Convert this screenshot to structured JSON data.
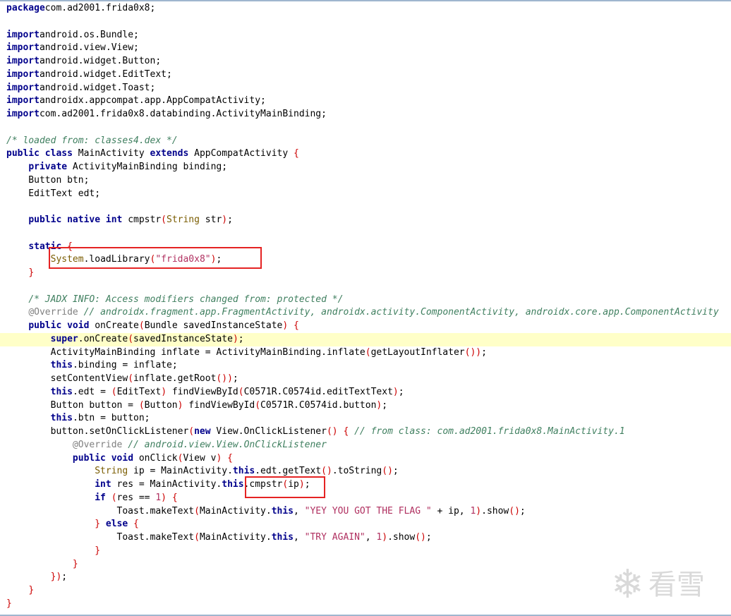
{
  "code": {
    "lines": [
      {
        "tokens": [
          [
            "kw",
            "package"
          ],
          [
            "",
            "com.ad2001.frida0x8;"
          ]
        ]
      },
      {
        "tokens": []
      },
      {
        "tokens": [
          [
            "kw",
            "import"
          ],
          [
            "",
            "android.os.Bundle;"
          ]
        ]
      },
      {
        "tokens": [
          [
            "kw",
            "import"
          ],
          [
            "",
            "android.view.View;"
          ]
        ]
      },
      {
        "tokens": [
          [
            "kw",
            "import"
          ],
          [
            "",
            "android.widget.Button;"
          ]
        ]
      },
      {
        "tokens": [
          [
            "kw",
            "import"
          ],
          [
            "",
            "android.widget.EditText;"
          ]
        ]
      },
      {
        "tokens": [
          [
            "kw",
            "import"
          ],
          [
            "",
            "android.widget.Toast;"
          ]
        ]
      },
      {
        "tokens": [
          [
            "kw",
            "import"
          ],
          [
            "",
            "androidx.appcompat.app.AppCompatActivity;"
          ]
        ]
      },
      {
        "tokens": [
          [
            "kw",
            "import"
          ],
          [
            "",
            "com.ad2001.frida0x8.databinding.ActivityMainBinding;"
          ]
        ]
      },
      {
        "tokens": []
      },
      {
        "tokens": [
          [
            "cm",
            "/* loaded from: classes4.dex */"
          ]
        ]
      },
      {
        "tokens": [
          [
            "kw",
            "public class"
          ],
          [
            "",
            " MainActivity "
          ],
          [
            "kw",
            "extends"
          ],
          [
            "",
            " AppCompatActivity "
          ],
          [
            "pn",
            "{"
          ]
        ]
      },
      {
        "tokens": [
          [
            "",
            "    "
          ],
          [
            "kw",
            "private"
          ],
          [
            "",
            " ActivityMainBinding binding;"
          ]
        ]
      },
      {
        "tokens": [
          [
            "",
            "    Button btn;"
          ]
        ]
      },
      {
        "tokens": [
          [
            "",
            "    EditText edt;"
          ]
        ]
      },
      {
        "tokens": []
      },
      {
        "tokens": [
          [
            "",
            "    "
          ],
          [
            "kw",
            "public native int"
          ],
          [
            "",
            " cmpstr"
          ],
          [
            "pn",
            "("
          ],
          [
            "cls",
            "String"
          ],
          [
            "",
            " str"
          ],
          [
            "pn",
            ")"
          ],
          [
            "",
            ";"
          ]
        ]
      },
      {
        "tokens": []
      },
      {
        "tokens": [
          [
            "",
            "    "
          ],
          [
            "kw",
            "static"
          ],
          [
            "",
            " "
          ],
          [
            "pn",
            "{"
          ]
        ]
      },
      {
        "tokens": [
          [
            "",
            "        "
          ],
          [
            "sys",
            "System"
          ],
          [
            "",
            ".loadLibrary"
          ],
          [
            "pn",
            "("
          ],
          [
            "st",
            "\"frida0x8\""
          ],
          [
            "pn",
            ")"
          ],
          [
            "",
            ";"
          ]
        ]
      },
      {
        "tokens": [
          [
            "",
            "    "
          ],
          [
            "pn",
            "}"
          ]
        ]
      },
      {
        "tokens": []
      },
      {
        "tokens": [
          [
            "",
            "    "
          ],
          [
            "cm",
            "/* JADX INFO: Access modifiers changed from: protected */"
          ]
        ]
      },
      {
        "tokens": [
          [
            "",
            "    "
          ],
          [
            "an",
            "@Override"
          ],
          [
            "",
            " "
          ],
          [
            "cm",
            "// androidx.fragment.app.FragmentActivity, androidx.activity.ComponentActivity, androidx.core.app.ComponentActivity"
          ]
        ]
      },
      {
        "tokens": [
          [
            "",
            "    "
          ],
          [
            "kw",
            "public void"
          ],
          [
            "",
            " onCreate"
          ],
          [
            "pn",
            "("
          ],
          [
            "",
            "Bundle savedInstanceState"
          ],
          [
            "pn",
            ")"
          ],
          [
            "",
            " "
          ],
          [
            "pn",
            "{"
          ]
        ]
      },
      {
        "hl": true,
        "tokens": [
          [
            "",
            "        "
          ],
          [
            "kw",
            "super"
          ],
          [
            "",
            ".onCreate"
          ],
          [
            "pn",
            "("
          ],
          [
            "",
            "savedInstanceState"
          ],
          [
            "pn",
            ")"
          ],
          [
            "",
            ";"
          ]
        ]
      },
      {
        "tokens": [
          [
            "",
            "        ActivityMainBinding inflate = ActivityMainBinding.inflate"
          ],
          [
            "pn",
            "("
          ],
          [
            "",
            "getLayoutInflater"
          ],
          [
            "pn",
            "())"
          ],
          [
            "",
            ";"
          ]
        ]
      },
      {
        "tokens": [
          [
            "",
            "        "
          ],
          [
            "kw",
            "this"
          ],
          [
            "",
            ".binding = inflate;"
          ]
        ]
      },
      {
        "tokens": [
          [
            "",
            "        setContentView"
          ],
          [
            "pn",
            "("
          ],
          [
            "",
            "inflate.getRoot"
          ],
          [
            "pn",
            "())"
          ],
          [
            "",
            ";"
          ]
        ]
      },
      {
        "tokens": [
          [
            "",
            "        "
          ],
          [
            "kw",
            "this"
          ],
          [
            "",
            ".edt = "
          ],
          [
            "pn",
            "("
          ],
          [
            "",
            "EditText"
          ],
          [
            "pn",
            ")"
          ],
          [
            "",
            " findViewById"
          ],
          [
            "pn",
            "("
          ],
          [
            "",
            "C0571R.C0574id.editTextText"
          ],
          [
            "pn",
            ")"
          ],
          [
            "",
            ";"
          ]
        ]
      },
      {
        "tokens": [
          [
            "",
            "        Button button = "
          ],
          [
            "pn",
            "("
          ],
          [
            "",
            "Button"
          ],
          [
            "pn",
            ")"
          ],
          [
            "",
            " findViewById"
          ],
          [
            "pn",
            "("
          ],
          [
            "",
            "C0571R.C0574id.button"
          ],
          [
            "pn",
            ")"
          ],
          [
            "",
            ";"
          ]
        ]
      },
      {
        "tokens": [
          [
            "",
            "        "
          ],
          [
            "kw",
            "this"
          ],
          [
            "",
            ".btn = button;"
          ]
        ]
      },
      {
        "tokens": [
          [
            "",
            "        button.setOnClickListener"
          ],
          [
            "pn",
            "("
          ],
          [
            "kw",
            "new"
          ],
          [
            "",
            " View.OnClickListener"
          ],
          [
            "pn",
            "()"
          ],
          [
            "",
            " "
          ],
          [
            "pn",
            "{"
          ],
          [
            "",
            " "
          ],
          [
            "cm",
            "// from class: com.ad2001.frida0x8.MainActivity.1"
          ]
        ]
      },
      {
        "tokens": [
          [
            "",
            "            "
          ],
          [
            "an",
            "@Override"
          ],
          [
            "",
            " "
          ],
          [
            "cm",
            "// android.view.View.OnClickListener"
          ]
        ]
      },
      {
        "tokens": [
          [
            "",
            "            "
          ],
          [
            "kw",
            "public void"
          ],
          [
            "",
            " onClick"
          ],
          [
            "pn",
            "("
          ],
          [
            "",
            "View v"
          ],
          [
            "pn",
            ")"
          ],
          [
            "",
            " "
          ],
          [
            "pn",
            "{"
          ]
        ]
      },
      {
        "tokens": [
          [
            "",
            "                "
          ],
          [
            "cls",
            "String"
          ],
          [
            "",
            " ip = MainActivity."
          ],
          [
            "kw",
            "this"
          ],
          [
            "",
            ".edt.getText"
          ],
          [
            "pn",
            "()"
          ],
          [
            "",
            ".toString"
          ],
          [
            "pn",
            "()"
          ],
          [
            "",
            ";"
          ]
        ]
      },
      {
        "tokens": [
          [
            "",
            "                "
          ],
          [
            "kw",
            "int"
          ],
          [
            "",
            " res = MainActivity."
          ],
          [
            "kw",
            "this"
          ],
          [
            "",
            ".cmpstr"
          ],
          [
            "pn",
            "("
          ],
          [
            "",
            "ip"
          ],
          [
            "pn",
            ")"
          ],
          [
            "",
            ";"
          ]
        ]
      },
      {
        "tokens": [
          [
            "",
            "                "
          ],
          [
            "kw",
            "if"
          ],
          [
            "",
            " "
          ],
          [
            "pn",
            "("
          ],
          [
            "",
            "res == "
          ],
          [
            "num",
            "1"
          ],
          [
            "pn",
            ")"
          ],
          [
            "",
            " "
          ],
          [
            "pn",
            "{"
          ]
        ]
      },
      {
        "tokens": [
          [
            "",
            "                    Toast.makeText"
          ],
          [
            "pn",
            "("
          ],
          [
            "",
            "MainActivity."
          ],
          [
            "kw",
            "this"
          ],
          [
            "",
            ", "
          ],
          [
            "st",
            "\"YEY YOU GOT THE FLAG \""
          ],
          [
            "",
            " + ip, "
          ],
          [
            "num",
            "1"
          ],
          [
            "pn",
            ")"
          ],
          [
            "",
            ".show"
          ],
          [
            "pn",
            "()"
          ],
          [
            "",
            ";"
          ]
        ]
      },
      {
        "tokens": [
          [
            "",
            "                "
          ],
          [
            "pn",
            "}"
          ],
          [
            "",
            " "
          ],
          [
            "kw",
            "else"
          ],
          [
            "",
            " "
          ],
          [
            "pn",
            "{"
          ]
        ]
      },
      {
        "tokens": [
          [
            "",
            "                    Toast.makeText"
          ],
          [
            "pn",
            "("
          ],
          [
            "",
            "MainActivity."
          ],
          [
            "kw",
            "this"
          ],
          [
            "",
            ", "
          ],
          [
            "st",
            "\"TRY AGAIN\""
          ],
          [
            "",
            ", "
          ],
          [
            "num",
            "1"
          ],
          [
            "pn",
            ")"
          ],
          [
            "",
            ".show"
          ],
          [
            "pn",
            "()"
          ],
          [
            "",
            ";"
          ]
        ]
      },
      {
        "tokens": [
          [
            "",
            "                "
          ],
          [
            "pn",
            "}"
          ]
        ]
      },
      {
        "tokens": [
          [
            "",
            "            "
          ],
          [
            "pn",
            "}"
          ]
        ]
      },
      {
        "tokens": [
          [
            "",
            "        "
          ],
          [
            "pn",
            "})"
          ],
          [
            "",
            ";"
          ]
        ]
      },
      {
        "tokens": [
          [
            "",
            "    "
          ],
          [
            "pn",
            "}"
          ]
        ]
      },
      {
        "tokens": [
          [
            "pn",
            "}"
          ]
        ]
      }
    ]
  },
  "watermark": {
    "logo_icon": "snowflake-icon",
    "text": "看雪"
  }
}
